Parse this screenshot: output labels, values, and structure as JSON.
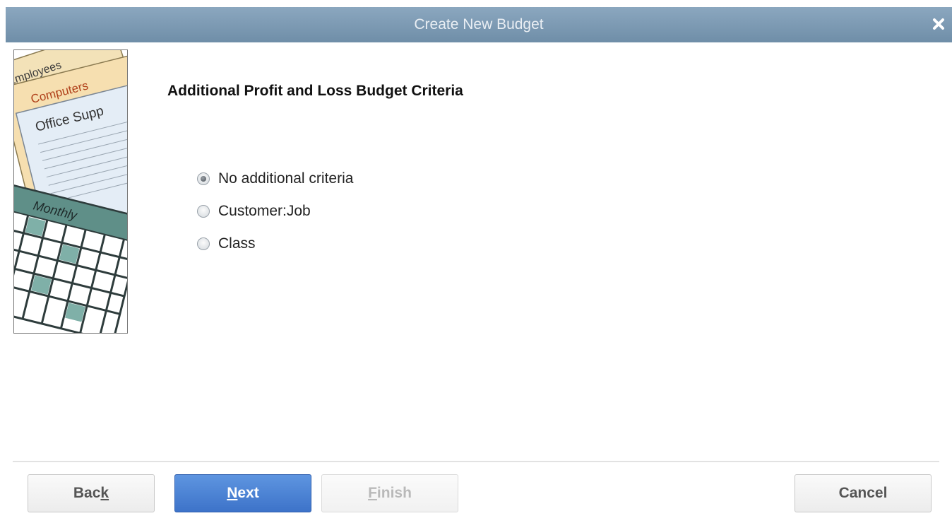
{
  "window": {
    "title": "Create New Budget"
  },
  "icons": {
    "close": "close-icon"
  },
  "illustration": {
    "labels": [
      "Employees",
      "Computers",
      "Office Supp",
      "Monthly"
    ]
  },
  "main": {
    "heading": "Additional Profit and Loss Budget Criteria",
    "options": [
      {
        "label": "No additional criteria",
        "selected": true
      },
      {
        "label": "Customer:Job",
        "selected": false
      },
      {
        "label": "Class",
        "selected": false
      }
    ]
  },
  "buttons": {
    "back": {
      "pre": "Bac",
      "key": "k",
      "post": ""
    },
    "next": {
      "pre": "",
      "key": "N",
      "post": "ext"
    },
    "finish": {
      "pre": "",
      "key": "F",
      "post": "inish",
      "enabled": false
    },
    "cancel": {
      "label": "Cancel"
    }
  },
  "colors": {
    "titlebar": "#7b98b2",
    "primary_button": "#4a80d4"
  }
}
